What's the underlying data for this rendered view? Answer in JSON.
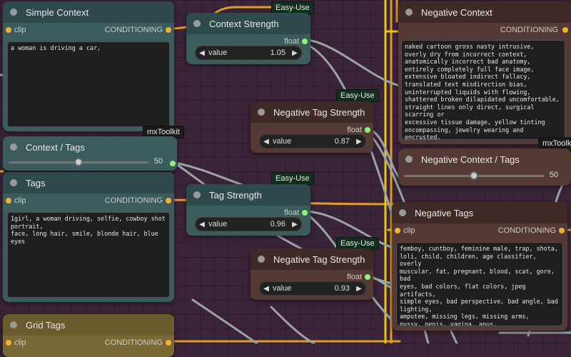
{
  "badges": {
    "easy_use_1": "Easy-Use",
    "easy_use_2": "Easy-Use",
    "easy_use_3": "Easy-Use",
    "easy_use_4": "Easy-Use",
    "mxtoolkit_1": "mxToolkit",
    "mxtoolkit_2": "mxToolkit"
  },
  "simple_context": {
    "title": "Simple Context",
    "input": "clip",
    "output": "CONDITIONING",
    "text": "a woman is driving a car,"
  },
  "context_strength": {
    "title": "Context Strength",
    "output": "float",
    "label": "value",
    "value": "1.05"
  },
  "context_tags": {
    "title": "Context / Tags",
    "value": "50",
    "fraction": 0.5
  },
  "tags": {
    "title": "Tags",
    "input": "clip",
    "output": "CONDITIONING",
    "text": "1girl, a woman driving, selfie, cowboy shot portrait,\nface, long hair, smile, blonde hair, blue eyes"
  },
  "tag_strength": {
    "title": "Tag Strength",
    "output": "float",
    "label": "value",
    "value": "0.96"
  },
  "grid_tags": {
    "title": "Grid Tags",
    "input": "clip",
    "output": "CONDITIONING"
  },
  "negative_tag_strength_1": {
    "title": "Negative Tag Strength",
    "output": "float",
    "label": "value",
    "value": "0.87"
  },
  "negative_tag_strength_2": {
    "title": "Negative Tag Strength",
    "output": "float",
    "label": "value",
    "value": "0.93"
  },
  "negative_context": {
    "title": "Negative Context",
    "output": "CONDITIONING",
    "text": "naked cartoon gross nasty intrusive,\noverly dry from incorrect context,\nanatomically incorrect bad anatomy,\nentirely completely full face image,\nextensive bloated indirect fallacy,\ntranslated text misdirection bias,\nuninterrupted liquids with flowing,\nshattered broken dilapidated uncomfortable,\nstraight lines only direct, surgical scarring or\nexcessive tissue damage, yellow tinting\nencompassing, jewelry wearing and encrusted,\nflat and perfect encompassing facial features,\nmisaligned teeth and discontinuitous,"
  },
  "negative_context_tags": {
    "title": "Negative Context / Tags",
    "value": "50",
    "fraction": 0.5
  },
  "negative_tags": {
    "title": "Negative Tags",
    "input": "clip",
    "output": "CONDITIONING",
    "text": "femboy, cuntboy, feminine male, trap, shota,\nloli, child, children, age classifier, overly\nmuscular, fat, pregnant, blood, scat, gore, bad\neyes, bad colors, flat colors, jpeg artifacts,\nsimple eyes, bad perspective, bad angle, bad\nlighting,\namputee, missing legs, missing arms,\npussy, penis, vagina, anus,\ncum, bad cum"
  },
  "icons": {
    "arrow_left": "◀",
    "arrow_right": "▶"
  }
}
